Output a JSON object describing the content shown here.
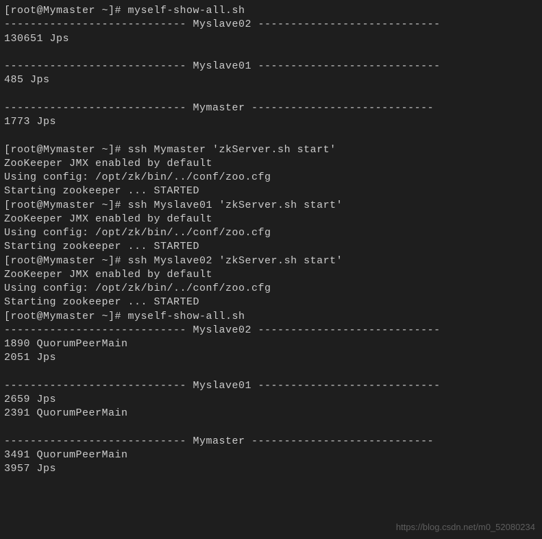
{
  "lines": [
    "[root@Mymaster ~]# myself-show-all.sh",
    "---------------------------- Myslave02 ----------------------------",
    "130651 Jps",
    "",
    "---------------------------- Myslave01 ----------------------------",
    "485 Jps",
    "",
    "---------------------------- Mymaster ----------------------------",
    "1773 Jps",
    "",
    "[root@Mymaster ~]# ssh Mymaster 'zkServer.sh start'",
    "ZooKeeper JMX enabled by default",
    "Using config: /opt/zk/bin/../conf/zoo.cfg",
    "Starting zookeeper ... STARTED",
    "[root@Mymaster ~]# ssh Myslave01 'zkServer.sh start'",
    "ZooKeeper JMX enabled by default",
    "Using config: /opt/zk/bin/../conf/zoo.cfg",
    "Starting zookeeper ... STARTED",
    "[root@Mymaster ~]# ssh Myslave02 'zkServer.sh start'",
    "ZooKeeper JMX enabled by default",
    "Using config: /opt/zk/bin/../conf/zoo.cfg",
    "Starting zookeeper ... STARTED",
    "[root@Mymaster ~]# myself-show-all.sh",
    "---------------------------- Myslave02 ----------------------------",
    "1890 QuorumPeerMain",
    "2051 Jps",
    "",
    "---------------------------- Myslave01 ----------------------------",
    "2659 Jps",
    "2391 QuorumPeerMain",
    "",
    "---------------------------- Mymaster ----------------------------",
    "3491 QuorumPeerMain",
    "3957 Jps"
  ],
  "watermark": "https://blog.csdn.net/m0_52080234"
}
